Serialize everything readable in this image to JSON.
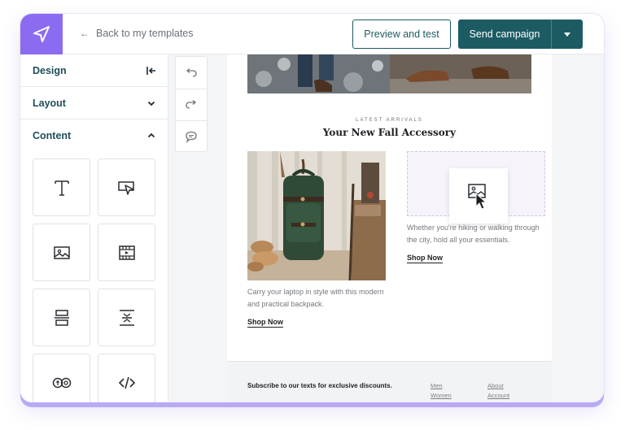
{
  "topbar": {
    "back_label": "Back to my templates",
    "preview_label": "Preview and test",
    "send_label": "Send campaign"
  },
  "sidebar": {
    "sections": [
      {
        "label": "Design",
        "icon": "collapse-left-icon"
      },
      {
        "label": "Layout",
        "icon": "chevron-down-icon"
      },
      {
        "label": "Content",
        "icon": "chevron-up-icon"
      }
    ],
    "tiles": [
      "text-icon",
      "button-icon",
      "image-icon",
      "video-icon",
      "divider-icon",
      "spacer-icon",
      "social-icon",
      "code-icon"
    ]
  },
  "tools": [
    "undo-icon",
    "redo-icon",
    "comment-icon"
  ],
  "email": {
    "eyebrow": "LATEST ARRIVALS",
    "headline": "Your New Fall Accessory",
    "left_desc": "Carry your laptop in style with this modern and practical backpack.",
    "left_cta": "Shop Now",
    "right_desc": "Whether you're hiking or walking through the city, hold all your essentials.",
    "right_cta": "Shop Now",
    "footer": {
      "subscribe": "Subscribe to our texts for exclusive discounts.",
      "links_col1": [
        "Men",
        "Women"
      ],
      "links_col2": [
        "About",
        "Account"
      ]
    }
  },
  "colors": {
    "brand_purple": "#8b6cf0",
    "primary_teal": "#1d5b63"
  }
}
